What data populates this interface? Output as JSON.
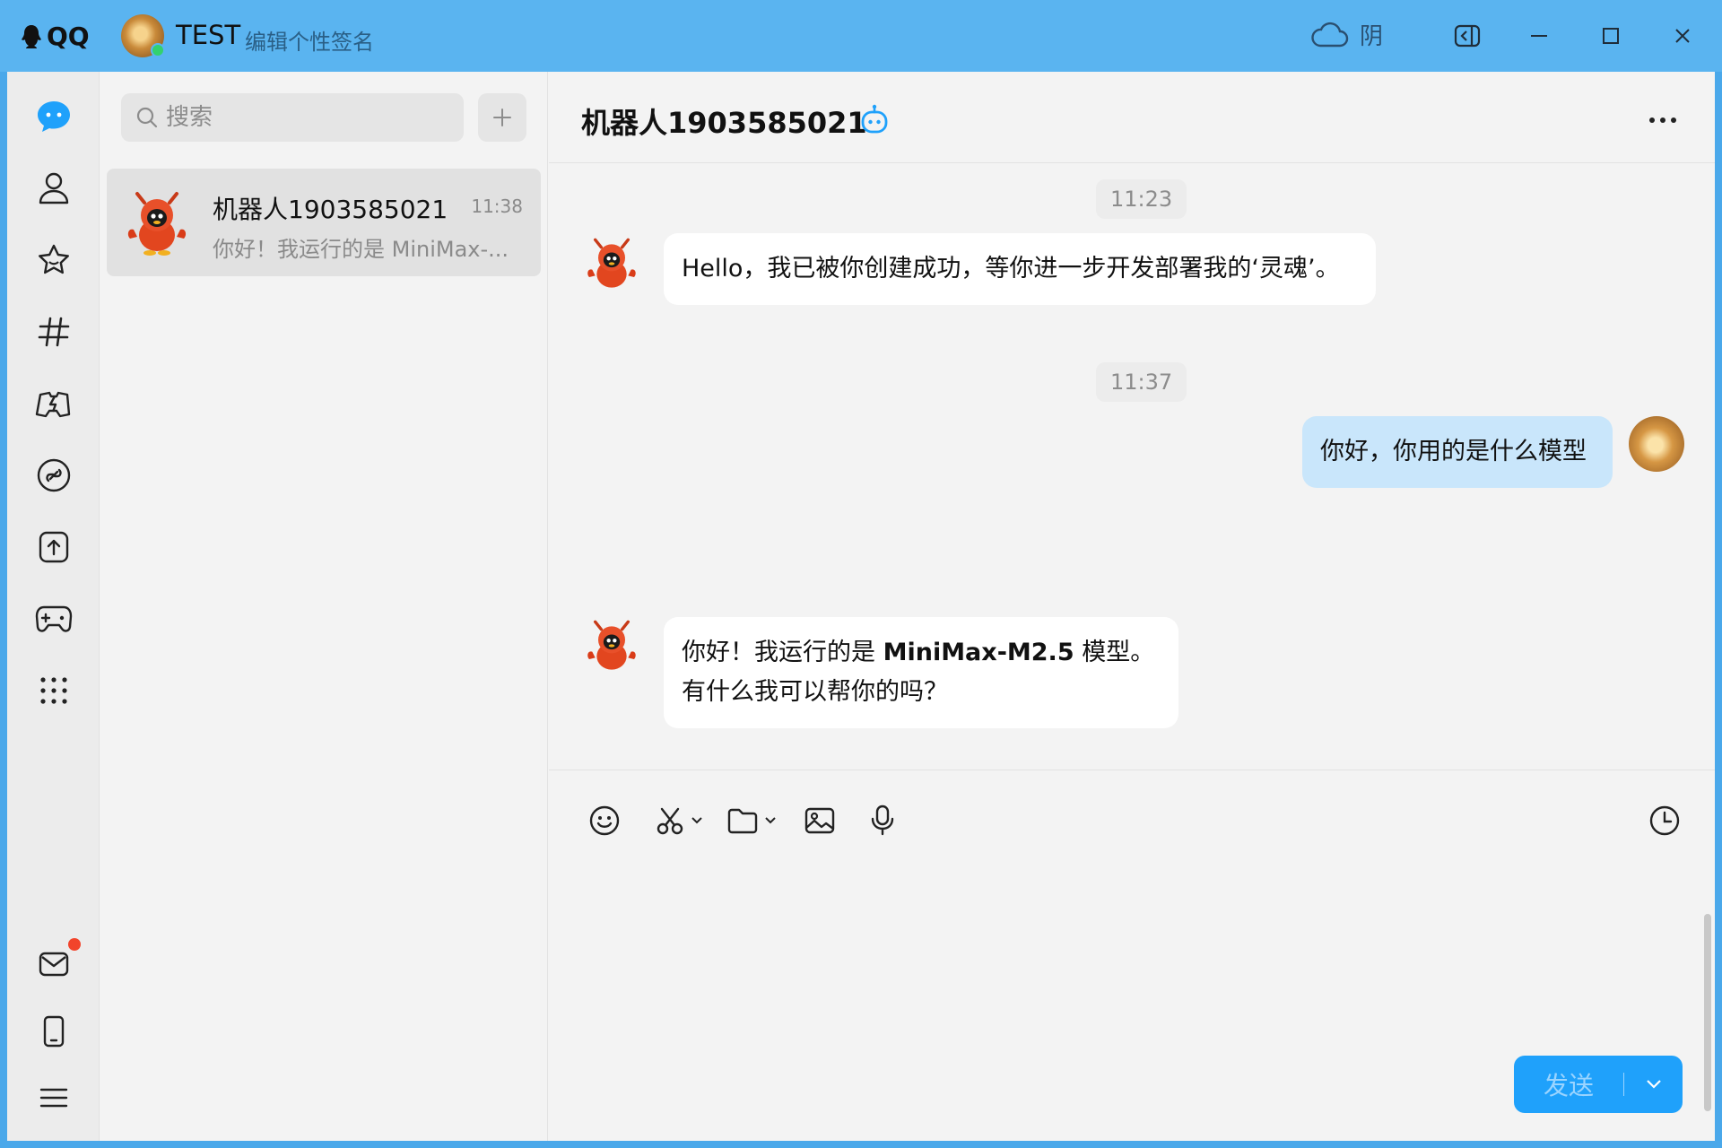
{
  "titlebar": {
    "app_name": "QQ",
    "user_name": "TEST",
    "signature_placeholder": "编辑个性签名",
    "weather_text": "阴"
  },
  "nav": {
    "items": [
      "messages",
      "contacts",
      "favorites",
      "channels",
      "games-center",
      "miniapp",
      "upload",
      "gamepad",
      "more-apps"
    ],
    "bottom": [
      "mail",
      "phone",
      "menu"
    ]
  },
  "sidebar": {
    "search_placeholder": "搜索",
    "conversations": [
      {
        "name": "机器人1903585021",
        "time": "11:38",
        "preview": "你好！我运行的是 MiniMax-..."
      }
    ]
  },
  "chat": {
    "title": "机器人1903585021",
    "messages": [
      {
        "type": "time",
        "text": "11:23"
      },
      {
        "type": "bot",
        "text": "Hello，我已被你创建成功，等你进一步开发部署我的‘灵魂’。"
      },
      {
        "type": "time",
        "text": "11:37"
      },
      {
        "type": "me",
        "text": "你好，你用的是什么模型"
      },
      {
        "type": "bot",
        "line1_a": "你好！我运行的是 ",
        "line1_b": "MiniMax-M2.5",
        "line1_c": " 模型。",
        "line2": "有什么我可以帮你的吗？"
      }
    ]
  },
  "composer": {
    "send_label": "发送"
  },
  "colors": {
    "titlebar": "#5ab4f0",
    "accent": "#1fa1fb",
    "my_bubble": "#c9e6fb",
    "badge": "#f2442b"
  }
}
